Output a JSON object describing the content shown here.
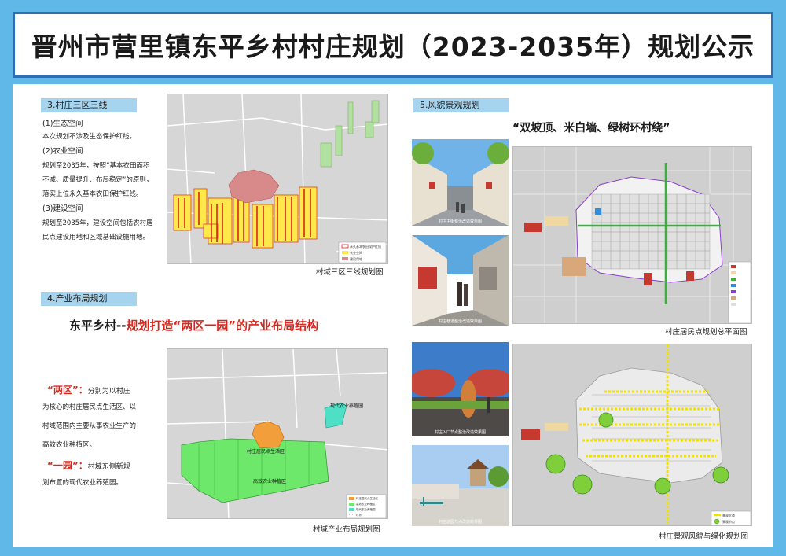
{
  "title": "晋州市营里镇东平乡村村庄规划（2023-2035年）规划公示",
  "sec3": {
    "tag": "3.村庄三区三线",
    "h1": "(1)生态空间",
    "p1": "本次规划不涉及生态保护红线。",
    "h2": "(2)农业空间",
    "p2a": "规划至2035年，按照“基本农田面积",
    "p2b": "不减、质量提升、布局稳定”的原则，",
    "p2c": "落实上位永久基本农田保护红线。",
    "h3": "(3)建设空间",
    "p3a": "规划至2035年，建设空间包括农村居",
    "p3b": "民点建设用地和区域基础设施用地。",
    "caption": "村域三区三线规划图",
    "legend": [
      "永久基本农田保护红线",
      "农业空间",
      "建设用地"
    ]
  },
  "sec4": {
    "tag": "4.产业布局规划",
    "headline_a": "东平乡村--",
    "headline_b": "规划打造“两区一园”的产业布局结构",
    "two_zones_label": "“两区”：",
    "two_zones_a": "分别为以村庄",
    "two_zones_b": "为核心的村庄居民点生活区、以",
    "two_zones_c": "村域范围内主要从事农业生产的",
    "two_zones_d": "高效农业种植区。",
    "one_park_label": "“一园”：",
    "one_park_a": "村域东侧新规",
    "one_park_b": "划布置的现代农业养殖园。",
    "caption": "村域产业布局规划图",
    "map_labels": {
      "village": "村庄居民点生活区",
      "farm": "高效农业种植区",
      "park": "现代农业养殖园"
    },
    "legend": [
      "村庄居民点生活区",
      "高效农业种植区",
      "现代农业养殖园",
      "村界"
    ]
  },
  "sec5": {
    "tag": "5.风貌景观规划",
    "slogan": "“双坡顶、米白墙、绿树环村绕”",
    "caption_top": "村庄居民点规划总平面图",
    "caption_bottom": "村庄景观风貌与绿化规划图",
    "photo_captions": [
      "村庄主街整治改造效果图",
      "村庄巷道整治改造效果图",
      "村庄入口节点整治改造效果图",
      "村庄游园节点改造效果图"
    ],
    "legend_bottom": [
      "景观大道",
      "景观节点"
    ]
  },
  "colors": {
    "border": "#2d6fb4",
    "background": "#5fb8e8",
    "tag": "#a6d4ef",
    "accent_red": "#d7261e"
  }
}
